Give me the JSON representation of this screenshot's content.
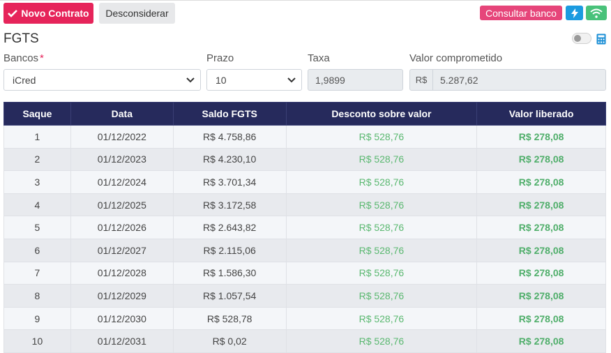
{
  "toolbar": {
    "novo_contrato": "Novo Contrato",
    "desconsiderar": "Desconsiderar",
    "consultar_banco": "Consultar banco"
  },
  "form": {
    "title": "FGTS",
    "bancos_label": "Bancos",
    "bancos_required_mark": "*",
    "bancos_value": "iCred",
    "prazo_label": "Prazo",
    "prazo_value": "10",
    "taxa_label": "Taxa",
    "taxa_value": "1,9899",
    "valor_label": "Valor comprometido",
    "valor_prefix": "R$",
    "valor_value": "5.287,62"
  },
  "table": {
    "headers": [
      "Saque",
      "Data",
      "Saldo FGTS",
      "Desconto sobre valor",
      "Valor liberado"
    ],
    "rows": [
      [
        "1",
        "01/12/2022",
        "R$ 4.758,86",
        "R$ 528,76",
        "R$ 278,08"
      ],
      [
        "2",
        "01/12/2023",
        "R$ 4.230,10",
        "R$ 528,76",
        "R$ 278,08"
      ],
      [
        "3",
        "01/12/2024",
        "R$ 3.701,34",
        "R$ 528,76",
        "R$ 278,08"
      ],
      [
        "4",
        "01/12/2025",
        "R$ 3.172,58",
        "R$ 528,76",
        "R$ 278,08"
      ],
      [
        "5",
        "01/12/2026",
        "R$ 2.643,82",
        "R$ 528,76",
        "R$ 278,08"
      ],
      [
        "6",
        "01/12/2027",
        "R$ 2.115,06",
        "R$ 528,76",
        "R$ 278,08"
      ],
      [
        "7",
        "01/12/2028",
        "R$ 1.586,30",
        "R$ 528,76",
        "R$ 278,08"
      ],
      [
        "8",
        "01/12/2029",
        "R$ 1.057,54",
        "R$ 528,76",
        "R$ 278,08"
      ],
      [
        "9",
        "01/12/2030",
        "R$ 528,78",
        "R$ 528,76",
        "R$ 278,08"
      ],
      [
        "10",
        "01/12/2031",
        "R$ 0,02",
        "R$ 528,76",
        "R$ 278,08"
      ]
    ]
  },
  "icons": [
    "check-icon",
    "flash-icon",
    "wifi-icon",
    "toggle-switch",
    "calculator-icon",
    "chevron-down-icon"
  ],
  "colors": {
    "primary_pink": "#e6245a",
    "header_navy": "#262a5c",
    "green": "#4fae6a",
    "blue": "#1b9be0"
  }
}
